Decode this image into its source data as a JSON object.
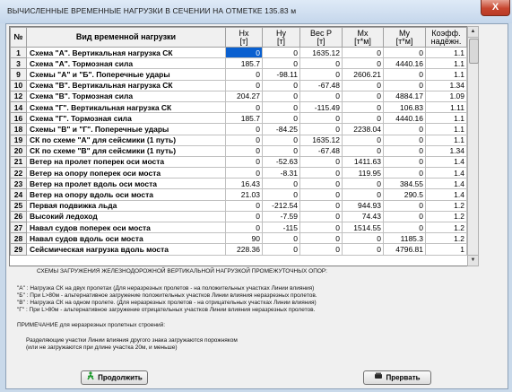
{
  "window": {
    "title": "ВЫЧИСЛЕННЫЕ ВРЕМЕННЫЕ НАГРУЗКИ В СЕЧЕНИИ НА ОТМЕТКЕ  135.83 м",
    "close": "X"
  },
  "table": {
    "headers": [
      [
        "№",
        ""
      ],
      [
        "Вид временной нагрузки",
        ""
      ],
      [
        "Hx",
        "[т]"
      ],
      [
        "Hy",
        "[т]"
      ],
      [
        "Вес  P",
        "[т]"
      ],
      [
        "Mx",
        "[т*м]"
      ],
      [
        "My",
        "[т*м]"
      ],
      [
        "Коэфф.",
        "надёжн."
      ]
    ],
    "rows": [
      [
        "1",
        "Схема \"А\".  Вертикальная нагрузка СК",
        "0",
        "0",
        "1635.12",
        "0",
        "0",
        "1.1"
      ],
      [
        "3",
        "Схема \"А\".  Тормозная сила",
        "185.7",
        "0",
        "0",
        "0",
        "4440.16",
        "1.1"
      ],
      [
        "9",
        "Схемы \"А\" и \"Б\". Поперечные удары",
        "0",
        "-98.11",
        "0",
        "2606.21",
        "0",
        "1.1"
      ],
      [
        "10",
        "Схема \"В\".  Вертикальная нагрузка СК",
        "0",
        "0",
        "-67.48",
        "0",
        "0",
        "1.34"
      ],
      [
        "12",
        "Схема \"В\".  Тормозная сила",
        "204.27",
        "0",
        "0",
        "0",
        "4884.17",
        "1.09"
      ],
      [
        "14",
        "Схема \"Г\".  Вертикальная нагрузка СК",
        "0",
        "0",
        "-115.49",
        "0",
        "106.83",
        "1.11"
      ],
      [
        "16",
        "Схема \"Г\".  Тормозная сила",
        "185.7",
        "0",
        "0",
        "0",
        "4440.16",
        "1.1"
      ],
      [
        "18",
        "Схемы \"В\" и \"Г\". Поперечные удары",
        "0",
        "-84.25",
        "0",
        "2238.04",
        "0",
        "1.1"
      ],
      [
        "19",
        "СК по схеме \"А\" для сейсмики (1 путь)",
        "0",
        "0",
        "1635.12",
        "0",
        "0",
        "1.1"
      ],
      [
        "20",
        "СК по схеме \"В\" для сейсмики (1 путь)",
        "0",
        "0",
        "-67.48",
        "0",
        "0",
        "1.34"
      ],
      [
        "21",
        "Ветер на пролет поперек оси моста",
        "0",
        "-52.63",
        "0",
        "1411.63",
        "0",
        "1.4"
      ],
      [
        "22",
        "Ветер на опору поперек оси моста",
        "0",
        "-8.31",
        "0",
        "119.95",
        "0",
        "1.4"
      ],
      [
        "23",
        "Ветер на пролет вдоль оси моста",
        "16.43",
        "0",
        "0",
        "0",
        "384.55",
        "1.4"
      ],
      [
        "24",
        "Ветер на опору вдоль оси моста",
        "21.03",
        "0",
        "0",
        "0",
        "290.5",
        "1.4"
      ],
      [
        "25",
        "Первая подвижка льда",
        "0",
        "-212.54",
        "0",
        "944.93",
        "0",
        "1.2"
      ],
      [
        "26",
        "Высокий ледоход",
        "0",
        "-7.59",
        "0",
        "74.43",
        "0",
        "1.2"
      ],
      [
        "27",
        "Навал судов  поперек оси моста",
        "0",
        "-115",
        "0",
        "1514.55",
        "0",
        "1.2"
      ],
      [
        "28",
        "Навал судов  вдоль оси моста",
        "90",
        "0",
        "0",
        "0",
        "1185.3",
        "1.2"
      ],
      [
        "29",
        "Сейсмическая нагрузка вдоль моста",
        "228.36",
        "0",
        "0",
        "0",
        "4796.81",
        "1"
      ]
    ]
  },
  "scrollbar": {
    "up": "▲",
    "down": "▼"
  },
  "notes": {
    "heading": "СХЕМЫ ЗАГРУЖЕНИЯ ЖЕЛЕЗНОДОРОЖНОЙ ВЕРТИКАЛЬНОЙ НАГРУЗКОЙ ПРОМЕЖУТОЧНЫХ ОПОР:",
    "lines": [
      "\"А\" : Нагрузка СК на двух пролетах (Для неразрезных пролетов - на положительных участках Линии влияния)",
      "\"Б\" : При L>80м - альтернативное загружение положительных участков Линии влияния неразрезных пролетов.",
      "\"В\" : Нагрузка СК на одном пролете. (Для неразрезных пролетов - на отрицательных участках Линии влияния)",
      "\"Г\" : При L>80м - альтернативное загружение отрицательных участков Линии влияния неразрезных пролетов."
    ],
    "remark_title": "ПРИМЕЧАНИЕ для неразрезных пролетных строений:",
    "remark_lines": [
      "Разделяющие участки Линии влияния другого знака загружаются порожняком",
      "(или не загружаются при длине участка 20м, и меньше)"
    ]
  },
  "buttons": {
    "continue": "Продолжить",
    "cancel": "Прервать"
  },
  "colors": {
    "selection": "#0a60d0"
  }
}
